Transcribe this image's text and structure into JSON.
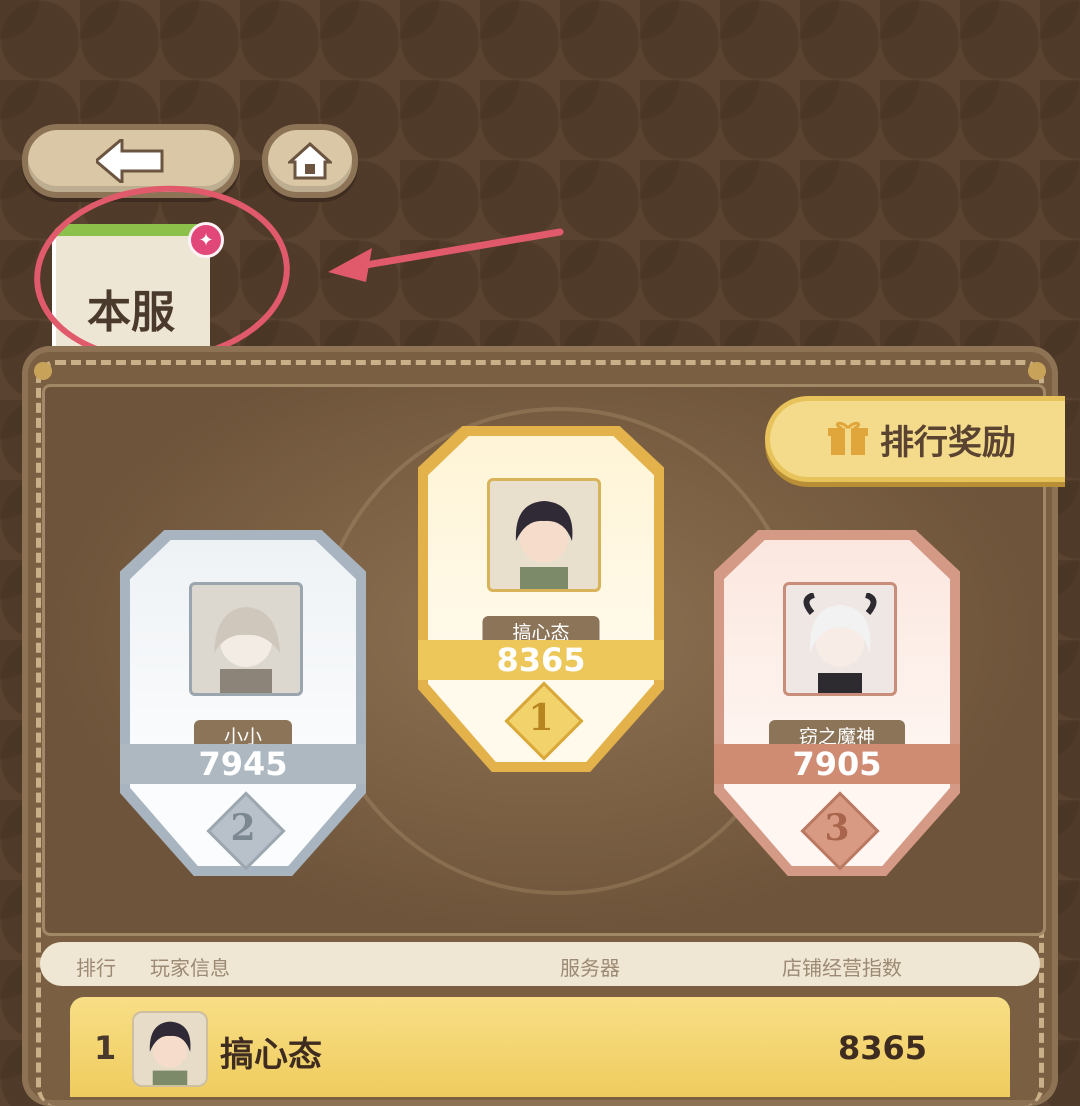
{
  "nav": {
    "back_icon": "arrow-left-icon",
    "home_icon": "home-icon"
  },
  "tab": {
    "label": "本服",
    "badge_icon": "sparkle-icon"
  },
  "reward_button": {
    "label": "排行奖励",
    "icon": "gift-icon"
  },
  "podium": {
    "first": {
      "name": "搞心态",
      "score": "8365",
      "rank": "1"
    },
    "second": {
      "name": "小小",
      "score": "7945",
      "rank": "2"
    },
    "third": {
      "name": "窃之魔神",
      "score": "7905",
      "rank": "3"
    }
  },
  "table": {
    "headers": {
      "rank": "排行",
      "player": "玩家信息",
      "server": "服务器",
      "index": "店铺经营指数"
    },
    "rows": [
      {
        "rank": "1",
        "name": "搞心态",
        "server": "",
        "score": "8365"
      }
    ]
  },
  "colors": {
    "highlight": "#e05a6b",
    "gold": "#e3b24a",
    "silver": "#a8b4bf",
    "bronze": "#d59a86"
  }
}
